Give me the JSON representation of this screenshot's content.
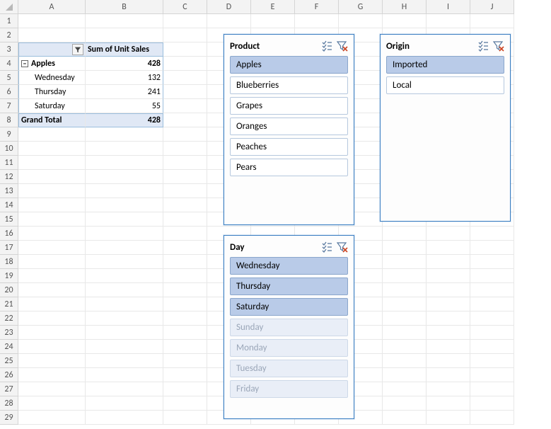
{
  "columns": [
    {
      "letter": "A",
      "width": 95
    },
    {
      "letter": "B",
      "width": 110
    },
    {
      "letter": "C",
      "width": 62
    },
    {
      "letter": "D",
      "width": 62
    },
    {
      "letter": "E",
      "width": 62
    },
    {
      "letter": "F",
      "width": 62
    },
    {
      "letter": "G",
      "width": 62
    },
    {
      "letter": "H",
      "width": 62
    },
    {
      "letter": "I",
      "width": 62
    },
    {
      "letter": "J",
      "width": 62
    }
  ],
  "row_count": 29,
  "pivot": {
    "value_field_header": "Sum of Unit Sales",
    "group_label": "Apples",
    "group_total": "428",
    "detail_rows": [
      {
        "label": "Wednesday",
        "value": "132"
      },
      {
        "label": "Thursday",
        "value": "241"
      },
      {
        "label": "Saturday",
        "value": "55"
      }
    ],
    "grand_total_label": "Grand Total",
    "grand_total_value": "428"
  },
  "slicers": {
    "product": {
      "title": "Product",
      "items": [
        {
          "label": "Apples",
          "state": "selected"
        },
        {
          "label": "Blueberries",
          "state": "normal"
        },
        {
          "label": "Grapes",
          "state": "normal"
        },
        {
          "label": "Oranges",
          "state": "normal"
        },
        {
          "label": "Peaches",
          "state": "normal"
        },
        {
          "label": "Pears",
          "state": "normal"
        }
      ]
    },
    "origin": {
      "title": "Origin",
      "items": [
        {
          "label": "Imported",
          "state": "selected"
        },
        {
          "label": "Local",
          "state": "normal"
        }
      ]
    },
    "day": {
      "title": "Day",
      "items": [
        {
          "label": "Wednesday",
          "state": "selected"
        },
        {
          "label": "Thursday",
          "state": "selected"
        },
        {
          "label": "Saturday",
          "state": "selected"
        },
        {
          "label": "Sunday",
          "state": "dimmed"
        },
        {
          "label": "Monday",
          "state": "dimmed"
        },
        {
          "label": "Tuesday",
          "state": "dimmed"
        },
        {
          "label": "Friday",
          "state": "dimmed"
        }
      ]
    }
  }
}
